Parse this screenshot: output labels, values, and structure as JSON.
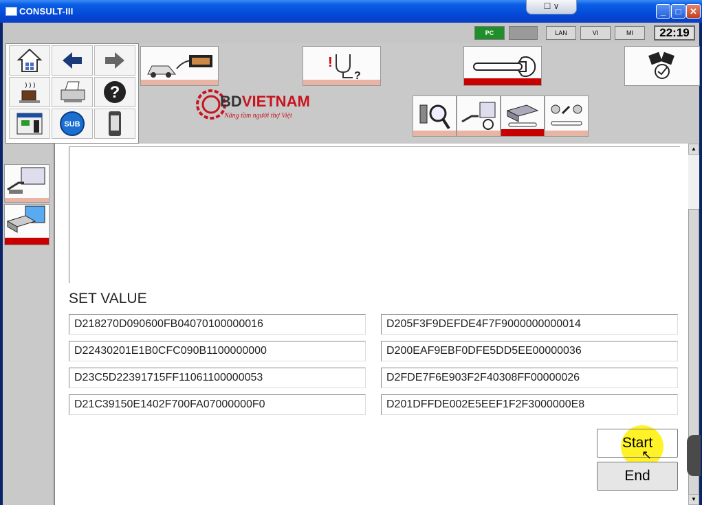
{
  "window": {
    "title": "CONSULT-III",
    "tab_drop_label": "☐ ∨",
    "min_label": "_",
    "max_label": "□",
    "close_label": "✕"
  },
  "status": {
    "pc_label": "PC",
    "lan_label": "LAN",
    "vi_label": "VI",
    "mi_label": "MI",
    "time": "22:19"
  },
  "logo": {
    "brand_prefix": "BD",
    "brand_name": "VIETNAM",
    "tagline": "Nâng tầm người thợ Việt"
  },
  "nav": {
    "sub_label": "SUB"
  },
  "main": {
    "set_value_label": "SET VALUE",
    "values_left": [
      "D218270D090600FB04070100000016",
      "D22430201E1B0CFC090B1100000000",
      "D23C5D22391715FF11061100000053",
      "D21C39150E1402F700FA07000000F0"
    ],
    "values_right": [
      "D205F3F9DEFDE4F7F9000000000014",
      "D200EAF9EBF0DFE5DD5EE00000036",
      "D2FDE7F6E903F2F40308FF00000026",
      "D201DFFDE002E5EEF1F2F3000000E8"
    ],
    "start_label": "Start",
    "end_label": "End"
  },
  "colors": {
    "titlebar": "#0446d6",
    "active_indicator": "#c80000",
    "inactive_indicator": "#e8b5a5",
    "pc_connected": "#1f8f2a"
  }
}
